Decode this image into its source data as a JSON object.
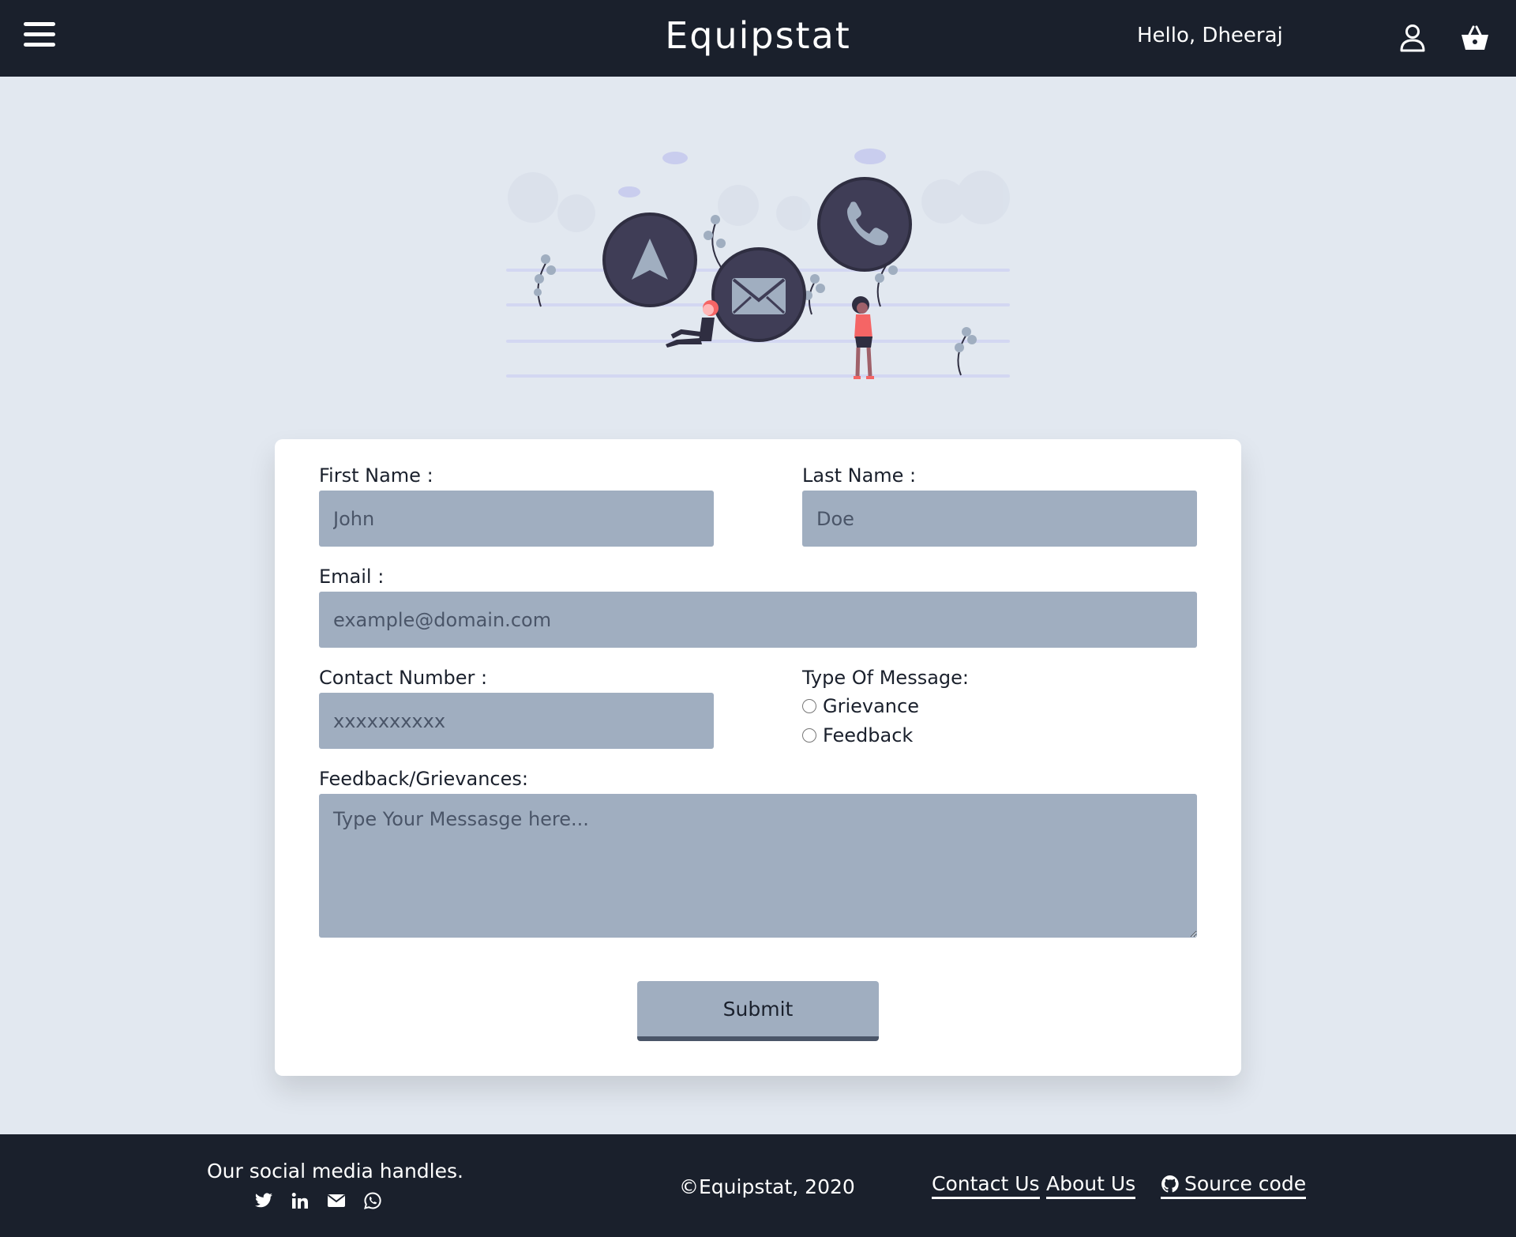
{
  "header": {
    "brand": "Equipstat",
    "greeting": "Hello, Dheeraj",
    "icons": {
      "menu": "hamburger-menu-icon",
      "user": "user-icon",
      "cart": "basket-icon"
    }
  },
  "illustration": {
    "icons": [
      "navigation-arrow-icon",
      "mail-icon",
      "phone-icon"
    ]
  },
  "form": {
    "first_name": {
      "label": "First Name :",
      "placeholder": "John"
    },
    "last_name": {
      "label": "Last Name :",
      "placeholder": "Doe"
    },
    "email": {
      "label": "Email :",
      "placeholder": "example@domain.com"
    },
    "contact": {
      "label": "Contact Number :",
      "placeholder": "xxxxxxxxxx"
    },
    "message_type": {
      "label": "Type Of Message:",
      "options": [
        {
          "label": "Grievance",
          "selected": false
        },
        {
          "label": "Feedback",
          "selected": false
        }
      ]
    },
    "message": {
      "label": "Feedback/Grievances:",
      "placeholder": "Type Your Messasge here..."
    },
    "submit_label": "Submit"
  },
  "footer": {
    "social_title": "Our social media handles.",
    "social_icons": [
      "twitter-icon",
      "linkedin-icon",
      "email-icon",
      "whatsapp-icon"
    ],
    "copyright": "©Equipstat, 2020",
    "links": [
      {
        "label": "Contact Us"
      },
      {
        "label": "About Us"
      },
      {
        "label": "Source code",
        "icon": "github-icon"
      }
    ]
  },
  "colors": {
    "dark": "#1a202c",
    "background": "#e2e8f0",
    "input": "#a0aec0",
    "accent_figure": "#f56565"
  }
}
